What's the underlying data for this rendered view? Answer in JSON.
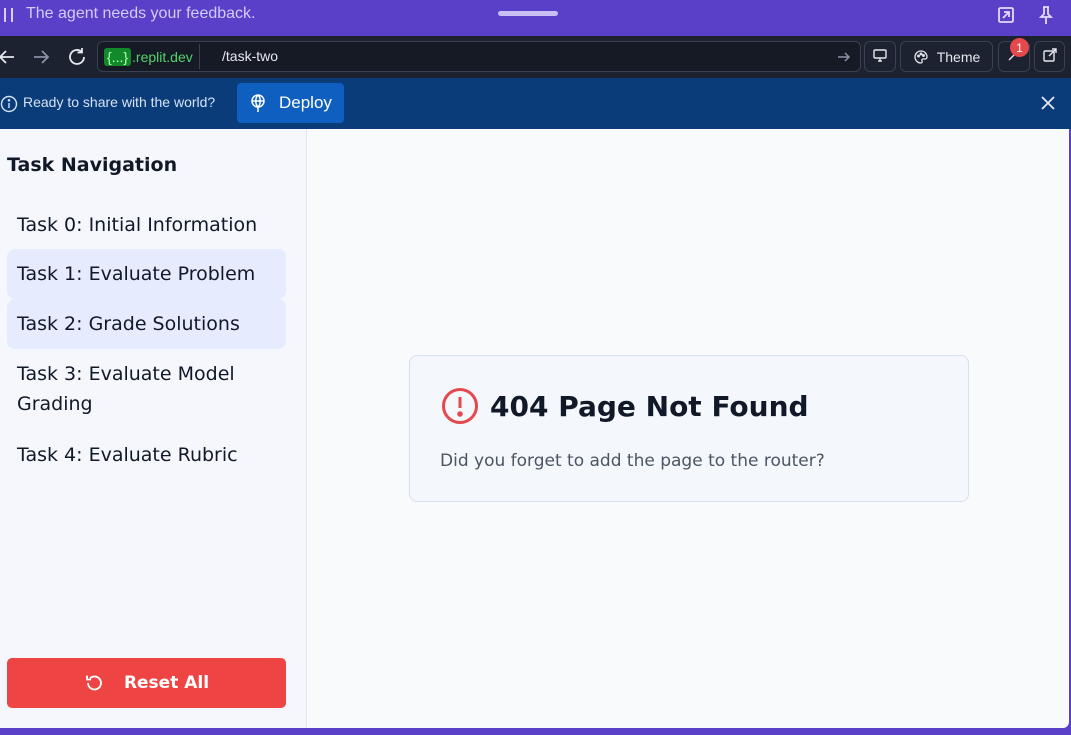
{
  "agent_bar": {
    "message": "The agent needs your feedback.",
    "icons": [
      "drag-grip-icon",
      "expand-arrow-icon",
      "pin-icon"
    ]
  },
  "browser": {
    "url_host_prefix": "{...}",
    "url_host": ".replit.dev",
    "url_path": "/task-two",
    "theme_label": "Theme",
    "devtools_badge": "1",
    "icons": [
      "back-icon",
      "forward-icon",
      "reload-icon",
      "go-arrow-icon",
      "screen-icon",
      "palette-icon",
      "wrench-icon",
      "external-link-icon"
    ]
  },
  "deploy_banner": {
    "prompt": "Ready to share with the world?",
    "button_label": "Deploy",
    "icons": [
      "info-icon",
      "deploy-icon",
      "close-icon"
    ]
  },
  "sidebar": {
    "title": "Task Navigation",
    "items": [
      {
        "label": "Task 0: Initial Information",
        "highlighted": false
      },
      {
        "label": "Task 1: Evaluate Problem",
        "highlighted": true
      },
      {
        "label": "Task 2: Grade Solutions",
        "highlighted": true
      },
      {
        "label": "Task 3: Evaluate Model Grading",
        "highlighted": false
      },
      {
        "label": "Task 4: Evaluate Rubric",
        "highlighted": false
      }
    ],
    "reset_label": "Reset All"
  },
  "not_found": {
    "heading": "404 Page Not Found",
    "description": "Did you forget to add the page to the router?"
  },
  "colors": {
    "agent_bar": "#5a3fc9",
    "browser_bar": "#1d2230",
    "deploy_banner": "#0b3c7a",
    "deploy_button": "#0f5fc0",
    "reset_button": "#ef4444",
    "error_icon": "#e5484d",
    "nav_highlight": "#e6ecfd"
  }
}
